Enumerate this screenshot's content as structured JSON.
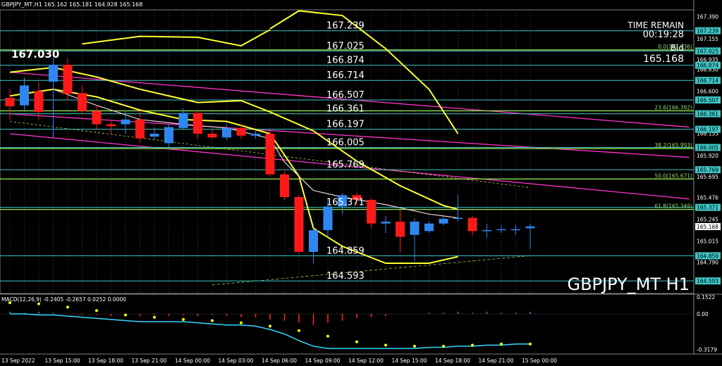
{
  "header": {
    "symbol_line": "GBPJPY_MT,H1  165.162 165.181 164.928 165.168",
    "big_price": "167.030",
    "time_remain_label": "TIME REMAIN",
    "time_remain_value": "00:19:28",
    "bid_label": "Bid",
    "bid_value": "165.168",
    "watermark": "GBPJPY_MT H1",
    "macd_label": "MACD(12,26,9) -0.2405 -0.2657 0.0252 0.0000"
  },
  "colors": {
    "background": "#000000",
    "bull": "#2f86f0",
    "bear": "#ff1a1a",
    "level_line": "#3fc6c6",
    "green_line": "#8ee04a",
    "band": "#ffff33",
    "trend": "#ff33cc",
    "ma_white": "#e8d6d6",
    "macd_signal": "#ffff00",
    "macd_line": "#33d9ff"
  },
  "chart_data": [
    {
      "type": "candlestick",
      "title": "GBPJPY_MT H1",
      "ylim": [
        164.46,
        167.46
      ],
      "x": [
        "13 Sep 12:00",
        "13 Sep 13:00",
        "13 Sep 14:00",
        "13 Sep 15:00",
        "13 Sep 16:00",
        "13 Sep 17:00",
        "13 Sep 18:00",
        "13 Sep 19:00",
        "13 Sep 20:00",
        "13 Sep 21:00",
        "13 Sep 22:00",
        "13 Sep 23:00",
        "14 Sep 00:00",
        "14 Sep 01:00",
        "14 Sep 02:00",
        "14 Sep 03:00",
        "14 Sep 04:00",
        "14 Sep 05:00",
        "14 Sep 06:00",
        "14 Sep 07:00",
        "14 Sep 08:00",
        "14 Sep 09:00",
        "14 Sep 10:00",
        "14 Sep 11:00",
        "14 Sep 12:00",
        "14 Sep 13:00",
        "14 Sep 14:00",
        "14 Sep 15:00",
        "14 Sep 16:00",
        "14 Sep 17:00",
        "14 Sep 18:00",
        "14 Sep 19:00",
        "14 Sep 20:00",
        "14 Sep 21:00",
        "14 Sep 22:00",
        "14 Sep 23:00",
        "15 Sep 00:00"
      ],
      "candles": [
        {
          "o": 166.53,
          "h": 166.62,
          "l": 166.3,
          "c": 166.44
        },
        {
          "o": 166.45,
          "h": 166.74,
          "l": 166.4,
          "c": 166.66
        },
        {
          "o": 166.6,
          "h": 166.7,
          "l": 166.3,
          "c": 166.38
        },
        {
          "o": 166.7,
          "h": 166.95,
          "l": 166.1,
          "c": 166.88
        },
        {
          "o": 166.88,
          "h": 166.95,
          "l": 166.5,
          "c": 166.57
        },
        {
          "o": 166.58,
          "h": 166.66,
          "l": 166.35,
          "c": 166.39
        },
        {
          "o": 166.39,
          "h": 166.45,
          "l": 166.2,
          "c": 166.25
        },
        {
          "o": 166.25,
          "h": 166.3,
          "l": 166.15,
          "c": 166.23
        },
        {
          "o": 166.25,
          "h": 166.38,
          "l": 166.15,
          "c": 166.3
        },
        {
          "o": 166.3,
          "h": 166.4,
          "l": 166.05,
          "c": 166.1
        },
        {
          "o": 166.12,
          "h": 166.22,
          "l": 166.08,
          "c": 166.15
        },
        {
          "o": 166.05,
          "h": 166.25,
          "l": 166.0,
          "c": 166.22
        },
        {
          "o": 166.21,
          "h": 166.42,
          "l": 166.2,
          "c": 166.37
        },
        {
          "o": 166.37,
          "h": 166.4,
          "l": 166.1,
          "c": 166.15
        },
        {
          "o": 166.15,
          "h": 166.2,
          "l": 166.1,
          "c": 166.11
        },
        {
          "o": 166.11,
          "h": 166.25,
          "l": 166.08,
          "c": 166.21
        },
        {
          "o": 166.21,
          "h": 166.25,
          "l": 166.1,
          "c": 166.13
        },
        {
          "o": 166.13,
          "h": 166.18,
          "l": 166.1,
          "c": 166.15
        },
        {
          "o": 166.15,
          "h": 166.18,
          "l": 165.7,
          "c": 165.72
        },
        {
          "o": 165.72,
          "h": 165.75,
          "l": 165.45,
          "c": 165.48
        },
        {
          "o": 165.48,
          "h": 165.5,
          "l": 164.88,
          "c": 164.9
        },
        {
          "o": 164.9,
          "h": 165.15,
          "l": 164.78,
          "c": 165.13
        },
        {
          "o": 165.13,
          "h": 165.45,
          "l": 165.05,
          "c": 165.38
        },
        {
          "o": 165.38,
          "h": 165.52,
          "l": 165.3,
          "c": 165.5
        },
        {
          "o": 165.5,
          "h": 165.53,
          "l": 165.4,
          "c": 165.45
        },
        {
          "o": 165.45,
          "h": 165.47,
          "l": 165.15,
          "c": 165.2
        },
        {
          "o": 165.2,
          "h": 165.28,
          "l": 165.1,
          "c": 165.22
        },
        {
          "o": 165.22,
          "h": 165.34,
          "l": 164.9,
          "c": 165.06
        },
        {
          "o": 165.08,
          "h": 165.25,
          "l": 164.8,
          "c": 165.22
        },
        {
          "o": 165.12,
          "h": 165.22,
          "l": 165.1,
          "c": 165.2
        },
        {
          "o": 165.2,
          "h": 165.27,
          "l": 165.18,
          "c": 165.25
        },
        {
          "o": 165.25,
          "h": 165.5,
          "l": 165.22,
          "c": 165.26
        },
        {
          "o": 165.26,
          "h": 165.28,
          "l": 165.08,
          "c": 165.12
        },
        {
          "o": 165.12,
          "h": 165.2,
          "l": 165.05,
          "c": 165.13
        },
        {
          "o": 165.13,
          "h": 165.18,
          "l": 165.1,
          "c": 165.14
        },
        {
          "o": 165.14,
          "h": 165.18,
          "l": 165.08,
          "c": 165.14
        },
        {
          "o": 165.15,
          "h": 165.2,
          "l": 164.93,
          "c": 165.17
        }
      ],
      "levels": [
        {
          "value": 167.239,
          "label": "167.239"
        },
        {
          "value": 167.025,
          "label": "167.025"
        },
        {
          "value": 166.874,
          "label": "166.874"
        },
        {
          "value": 166.714,
          "label": "166.714"
        },
        {
          "value": 166.507,
          "label": "166.507"
        },
        {
          "value": 166.361,
          "label": "166.361"
        },
        {
          "value": 166.197,
          "label": "166.197"
        },
        {
          "value": 166.005,
          "label": "166.005"
        },
        {
          "value": 165.769,
          "label": "165.769"
        },
        {
          "value": 165.371,
          "label": "165.371"
        },
        {
          "value": 164.859,
          "label": "164.859"
        },
        {
          "value": 164.593,
          "label": "164.593"
        }
      ],
      "fib_levels": [
        {
          "value": 167.036,
          "label": "0.0(167.036)"
        },
        {
          "value": 166.392,
          "label": "23.6(166.392)"
        },
        {
          "value": 165.993,
          "label": "38.2(165.993)"
        },
        {
          "value": 165.671,
          "label": "50.0(165.671)"
        },
        {
          "value": 165.349,
          "label": "61.8(165.349)"
        }
      ],
      "y_ticks": [
        "167.390",
        "167.155",
        "166.935",
        "166.830",
        "166.600",
        "166.370",
        "166.155",
        "165.920",
        "165.695",
        "165.476",
        "165.245",
        "165.015",
        "164.790"
      ],
      "x_tick_labels": [
        {
          "label": "13 Sep 2022",
          "index": 0
        },
        {
          "label": "13 Sep 15:00",
          "index": 3
        },
        {
          "label": "13 Sep 18:00",
          "index": 6
        },
        {
          "label": "13 Sep 21:00",
          "index": 9
        },
        {
          "label": "14 Sep 00:00",
          "index": 12
        },
        {
          "label": "14 Sep 03:00",
          "index": 15
        },
        {
          "label": "14 Sep 06:00",
          "index": 18
        },
        {
          "label": "14 Sep 09:00",
          "index": 21
        },
        {
          "label": "14 Sep 12:00",
          "index": 24
        },
        {
          "label": "14 Sep 15:00",
          "index": 27
        },
        {
          "label": "14 Sep 18:00",
          "index": 30
        },
        {
          "label": "14 Sep 21:00",
          "index": 33
        },
        {
          "label": "15 Sep 00:00",
          "index": 36
        }
      ],
      "bid": 165.168,
      "trend_lines": [
        {
          "from": [
            0,
            166.8
          ],
          "to": [
            47,
            166.22
          ]
        },
        {
          "from": [
            0,
            166.36
          ],
          "to": [
            47,
            165.9
          ]
        },
        {
          "from": [
            0,
            166.15
          ],
          "to": [
            47,
            165.46
          ]
        }
      ],
      "bollinger_upper": [
        [
          18,
          167.26
        ],
        [
          20,
          167.45
        ],
        [
          23,
          167.4
        ],
        [
          26,
          167.05
        ],
        [
          29,
          166.62
        ],
        [
          31,
          166.15
        ]
      ],
      "bollinger_upper_early": [
        [
          5,
          167.1
        ],
        [
          9,
          167.18
        ],
        [
          13,
          167.17
        ],
        [
          16,
          167.08
        ],
        [
          18,
          167.25
        ]
      ],
      "bollinger_mid": [
        [
          0,
          166.8
        ],
        [
          3,
          166.85
        ],
        [
          6,
          166.75
        ],
        [
          9,
          166.62
        ],
        [
          13,
          166.48
        ],
        [
          16,
          166.5
        ],
        [
          18,
          166.38
        ],
        [
          21,
          166.18
        ],
        [
          24,
          165.86
        ],
        [
          27,
          165.6
        ],
        [
          30,
          165.39
        ],
        [
          31,
          165.35
        ]
      ],
      "bollinger_lower": [
        [
          0,
          166.55
        ],
        [
          3,
          166.62
        ],
        [
          6,
          166.54
        ],
        [
          9,
          166.4
        ],
        [
          12,
          166.3
        ],
        [
          15,
          166.28
        ],
        [
          18,
          166.15
        ],
        [
          20,
          165.7
        ],
        [
          21,
          165.15
        ],
        [
          23,
          164.96
        ],
        [
          26,
          164.78
        ],
        [
          29,
          164.78
        ],
        [
          31,
          164.85
        ]
      ],
      "ma_white": [
        [
          3,
          166.62
        ],
        [
          6,
          166.45
        ],
        [
          9,
          166.3
        ],
        [
          12,
          166.25
        ],
        [
          15,
          166.21
        ],
        [
          18,
          166.1
        ],
        [
          19,
          165.85
        ],
        [
          21,
          165.55
        ],
        [
          23,
          165.48
        ],
        [
          26,
          165.4
        ],
        [
          29,
          165.3
        ],
        [
          31,
          165.26
        ]
      ],
      "ylim_range_note": "",
      "macd": {
        "ylim": [
          -0.36,
          0.17
        ],
        "y_ticks": [
          "0.1522",
          "0.00",
          "-0.3179"
        ],
        "histogram": [
          0.02,
          0.01,
          0.02,
          0.01,
          0.0,
          -0.01,
          -0.01,
          -0.02,
          -0.01,
          -0.02,
          -0.01,
          -0.02,
          -0.01,
          -0.02,
          -0.01,
          -0.02,
          -0.03,
          -0.03,
          -0.05,
          -0.06,
          -0.08,
          -0.1,
          -0.08,
          -0.06,
          -0.04,
          -0.03,
          -0.02,
          0.0,
          0.0,
          0.01,
          0.01,
          0.02,
          0.01,
          0.02,
          0.01,
          0.01,
          0.02
        ],
        "signal": [
          0.1,
          0.1,
          0.09,
          0.08,
          0.06,
          0.05,
          0.03,
          0.01,
          -0.01,
          -0.02,
          -0.03,
          -0.04,
          -0.05,
          -0.06,
          -0.06,
          -0.07,
          -0.08,
          -0.09,
          -0.11,
          -0.13,
          -0.15,
          -0.18,
          -0.2,
          -0.23,
          -0.25,
          -0.27,
          -0.28,
          -0.29,
          -0.29,
          -0.29,
          -0.29,
          -0.28,
          -0.28,
          -0.27,
          -0.27,
          -0.27,
          -0.27
        ],
        "macd_line": [
          0.0,
          0.0,
          -0.01,
          -0.01,
          -0.02,
          -0.03,
          -0.04,
          -0.05,
          -0.06,
          -0.07,
          -0.07,
          -0.07,
          -0.07,
          -0.08,
          -0.09,
          -0.1,
          -0.1,
          -0.11,
          -0.14,
          -0.18,
          -0.24,
          -0.29,
          -0.31,
          -0.31,
          -0.31,
          -0.31,
          -0.31,
          -0.31,
          -0.31,
          -0.3,
          -0.3,
          -0.29,
          -0.29,
          -0.28,
          -0.28,
          -0.27,
          -0.27
        ]
      }
    }
  ]
}
